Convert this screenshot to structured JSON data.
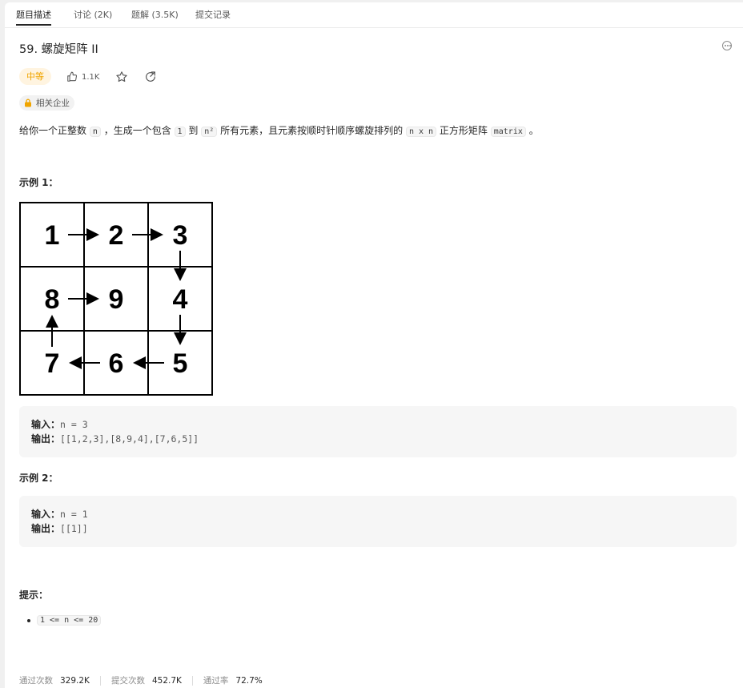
{
  "tabs": [
    {
      "label": "题目描述",
      "active": true
    },
    {
      "label": "讨论 (2K)",
      "active": false
    },
    {
      "label": "题解 (3.5K)",
      "active": false
    },
    {
      "label": "提交记录",
      "active": false
    }
  ],
  "problem": {
    "title": "59. 螺旋矩阵 II",
    "difficulty": "中等",
    "likes": "1.1K",
    "company_tag": "相关企业"
  },
  "description": {
    "p1": "给你一个正整数",
    "c1": "n",
    "p2": "，生成一个包含",
    "c2": "1",
    "p3": "到",
    "c3": "n²",
    "p4": "所有元素，且元素按顺时针顺序螺旋排列的",
    "c4": "n x n",
    "p5": "正方形矩阵",
    "c5": "matrix",
    "p6": "。"
  },
  "example1": {
    "label": "示例 1：",
    "grid": [
      "1",
      "2",
      "3",
      "8",
      "9",
      "4",
      "7",
      "6",
      "5"
    ],
    "input_label": "输入：",
    "input": "n = 3",
    "output_label": "输出：",
    "output": "[[1,2,3],[8,9,4],[7,6,5]]"
  },
  "example2": {
    "label": "示例 2：",
    "input_label": "输入：",
    "input": "n = 1",
    "output_label": "输出：",
    "output": "[[1]]"
  },
  "hints": {
    "label": "提示：",
    "items": [
      "1 <= n <= 20"
    ]
  },
  "stats": {
    "accepted_label": "通过次数",
    "accepted": "329.2K",
    "submissions_label": "提交次数",
    "submissions": "452.7K",
    "rate_label": "通过率",
    "rate": "72.7%"
  },
  "colors": {
    "difficulty_medium_text": "#f0a500",
    "difficulty_medium_bg": "#fff4e0",
    "company_lock": "#f0a500"
  },
  "icons": [
    "thumbs-up-icon",
    "star-icon",
    "share-icon",
    "more-icon",
    "lock-icon"
  ]
}
